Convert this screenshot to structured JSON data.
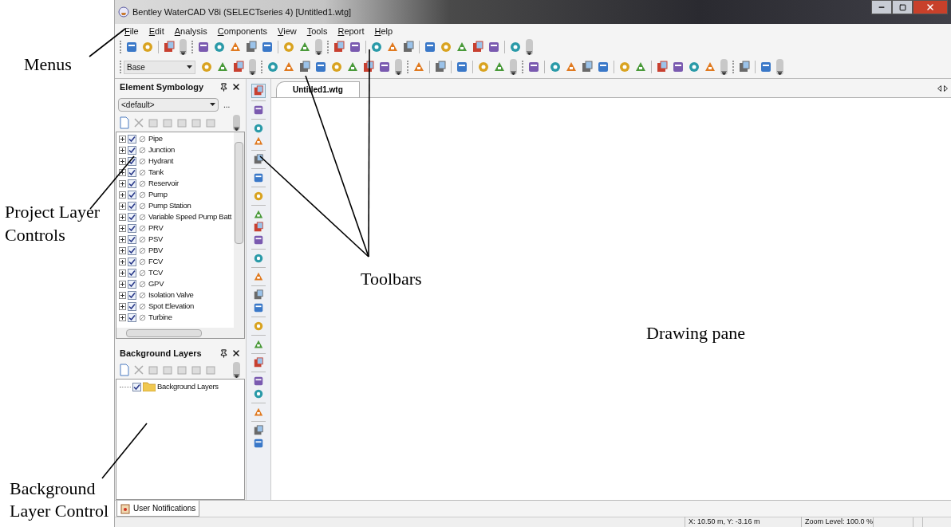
{
  "window": {
    "title": "Bentley WaterCAD V8i (SELECTseries 4) [Untitled1.wtg]"
  },
  "menus": [
    {
      "label": "File"
    },
    {
      "label": "Edit"
    },
    {
      "label": "Analysis"
    },
    {
      "label": "Components"
    },
    {
      "label": "View"
    },
    {
      "label": "Tools"
    },
    {
      "label": "Report"
    },
    {
      "label": "Help"
    }
  ],
  "scenario_dropdown": {
    "value": "Base"
  },
  "element_symbology": {
    "title": "Element Symbology",
    "profile": "<default>",
    "more_button": "...",
    "layers": [
      {
        "label": "Pipe",
        "checked": true
      },
      {
        "label": "Junction",
        "checked": true
      },
      {
        "label": "Hydrant",
        "checked": true
      },
      {
        "label": "Tank",
        "checked": true
      },
      {
        "label": "Reservoir",
        "checked": true
      },
      {
        "label": "Pump",
        "checked": true
      },
      {
        "label": "Pump Station",
        "checked": true
      },
      {
        "label": "Variable Speed Pump Batt",
        "checked": true
      },
      {
        "label": "PRV",
        "checked": true
      },
      {
        "label": "PSV",
        "checked": true
      },
      {
        "label": "PBV",
        "checked": true
      },
      {
        "label": "FCV",
        "checked": true
      },
      {
        "label": "TCV",
        "checked": true
      },
      {
        "label": "GPV",
        "checked": true
      },
      {
        "label": "Isolation Valve",
        "checked": true
      },
      {
        "label": "Spot Elevation",
        "checked": true
      },
      {
        "label": "Turbine",
        "checked": true
      }
    ]
  },
  "background_layers": {
    "title": "Background Layers",
    "layers": [
      {
        "label": "Background Layers",
        "checked": true
      }
    ]
  },
  "document_tabs": [
    {
      "label": "Untitled1.wtg",
      "selected": true
    }
  ],
  "bottom_tabs": [
    {
      "label": "User Notifications",
      "selected": true
    }
  ],
  "status_bar": {
    "coordinates": "X: 10.50 m, Y: -3.16 m",
    "zoom": "Zoom Level: 100.0 %"
  },
  "annotations": [
    {
      "label": "Menus"
    },
    {
      "label": "Project Layer Controls"
    },
    {
      "label": "Toolbars"
    },
    {
      "label": "Drawing pane"
    },
    {
      "label": "Background Layer Control"
    }
  ]
}
